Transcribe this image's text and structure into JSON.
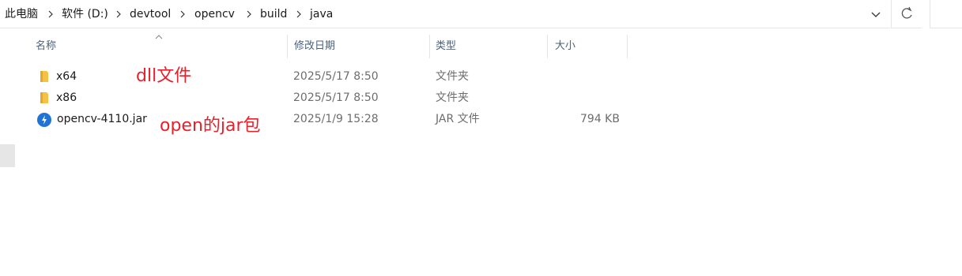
{
  "breadcrumb": [
    "此电脑",
    "软件 (D:)",
    "devtool",
    "opencv",
    "build",
    "java"
  ],
  "columns": {
    "name": "名称",
    "date": "修改日期",
    "type": "类型",
    "size": "大小"
  },
  "rows": [
    {
      "name": "x64",
      "date": "2025/5/17 8:50",
      "type": "文件夹",
      "size": "",
      "icon": "folder-icon"
    },
    {
      "name": "x86",
      "date": "2025/5/17 8:50",
      "type": "文件夹",
      "size": "",
      "icon": "folder-icon"
    },
    {
      "name": "opencv-4110.jar",
      "date": "2025/1/9 15:28",
      "type": "JAR 文件",
      "size": "794 KB",
      "icon": "jar-file-icon"
    }
  ],
  "annotations": {
    "dll": "dll文件",
    "jar": "open的jar包"
  },
  "colors": {
    "header_text": "#4c607a",
    "annotation": "#e8202a",
    "folder": "#f6c245"
  }
}
